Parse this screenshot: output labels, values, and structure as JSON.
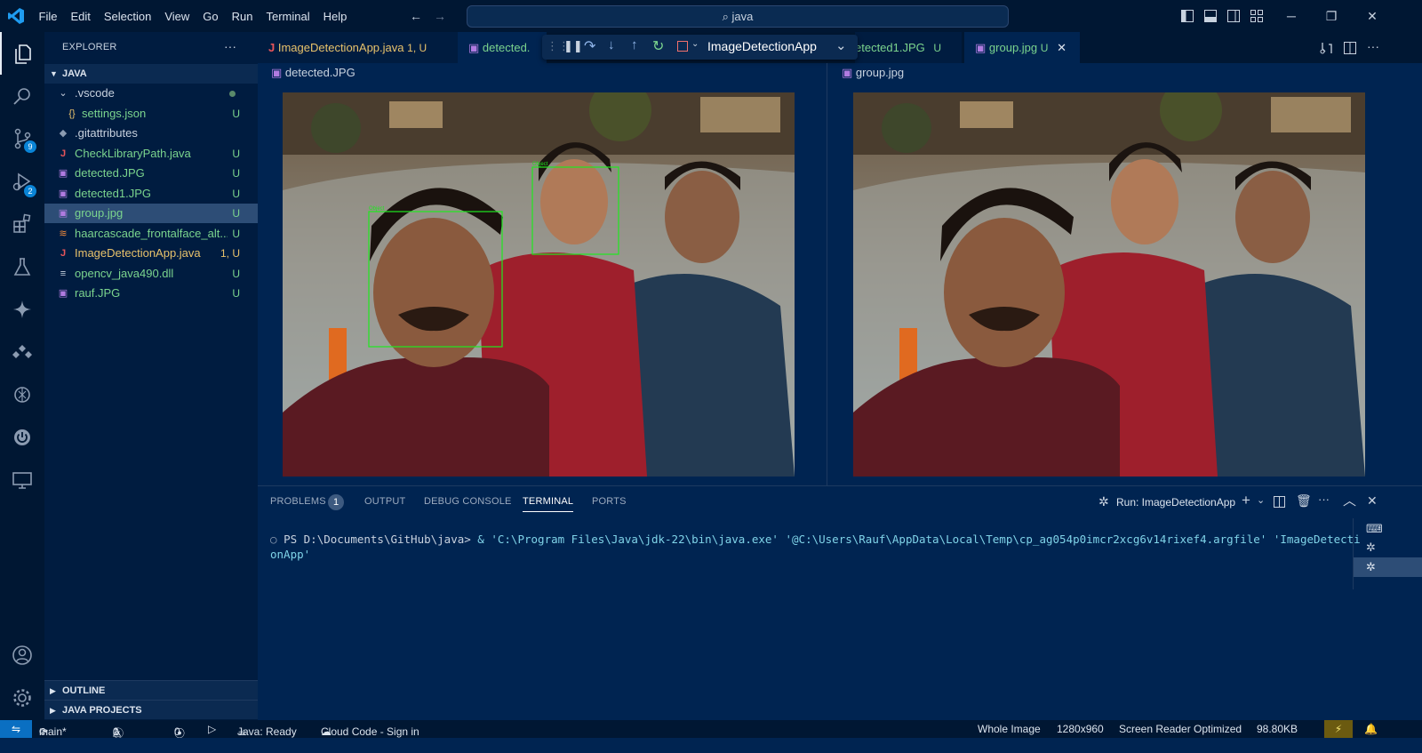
{
  "menu": [
    "File",
    "Edit",
    "Selection",
    "View",
    "Go",
    "Run",
    "Terminal",
    "Help"
  ],
  "search": {
    "text": "java"
  },
  "explorer": {
    "title": "EXPLORER",
    "more": "···",
    "root": "JAVA",
    "items": [
      {
        "name": ".vscode",
        "status": "",
        "kind": "folder"
      },
      {
        "name": "settings.json",
        "status": "U",
        "kind": "json"
      },
      {
        "name": ".gitattributes",
        "status": "",
        "kind": "git"
      },
      {
        "name": "CheckLibraryPath.java",
        "status": "U",
        "kind": "java"
      },
      {
        "name": "detected.JPG",
        "status": "U",
        "kind": "image"
      },
      {
        "name": "detected1.JPG",
        "status": "U",
        "kind": "image"
      },
      {
        "name": "group.jpg",
        "status": "U",
        "kind": "image"
      },
      {
        "name": "haarcascade_frontalface_alt...",
        "status": "U",
        "kind": "xml"
      },
      {
        "name": "ImageDetectionApp.java",
        "status": "1, U",
        "kind": "java"
      },
      {
        "name": "opencv_java490.dll",
        "status": "U",
        "kind": "dll"
      },
      {
        "name": "rauf.JPG",
        "status": "U",
        "kind": "image"
      }
    ],
    "outline": "OUTLINE",
    "java_projects": "JAVA PROJECTS"
  },
  "tabs": [
    {
      "label": "ImageDetectionApp.java",
      "status": "1, U"
    },
    {
      "label": "detected.",
      "status": ""
    },
    {
      "label": "etected1.JPG",
      "status": "U"
    },
    {
      "label": "group.jpg",
      "status": "U"
    }
  ],
  "debug": {
    "config": "ImageDetectionApp"
  },
  "breadcrumbs": {
    "left": "detected.JPG",
    "right": "group.jpg"
  },
  "detections": {
    "label": "Object"
  },
  "panel": {
    "tabs": [
      "PROBLEMS",
      "OUTPUT",
      "DEBUG CONSOLE",
      "TERMINAL",
      "PORTS"
    ],
    "problems_count": "1",
    "run_label": "Run: ImageDetectionApp"
  },
  "terminal": {
    "prompt": "PS D:\\Documents\\GitHub\\java>",
    "command_line1": " & 'C:\\Program Files\\Java\\jdk-22\\bin\\java.exe' '@C:\\Users\\Rauf\\AppData\\Local\\Temp\\cp_ag054p0imcr2xcg6v14rixef4.argfile' 'ImageDetecti",
    "command_line2": "onApp'"
  },
  "badges": {
    "scm": "9",
    "debug": "2"
  },
  "statusbar": {
    "branch": "main*",
    "errors": "0",
    "warnings": "1",
    "ports": "0",
    "java": "Java: Ready",
    "cloud": "Cloud Code - Sign in",
    "view": "Whole Image",
    "dims": "1280x960",
    "screen_reader": "Screen Reader Optimized",
    "size": "98.80KB"
  },
  "colors": {
    "accent": "#0a6fc2",
    "git_untracked": "#7bd48e",
    "java_modified": "#e8c26b",
    "detection_box": "#1fe81f"
  }
}
